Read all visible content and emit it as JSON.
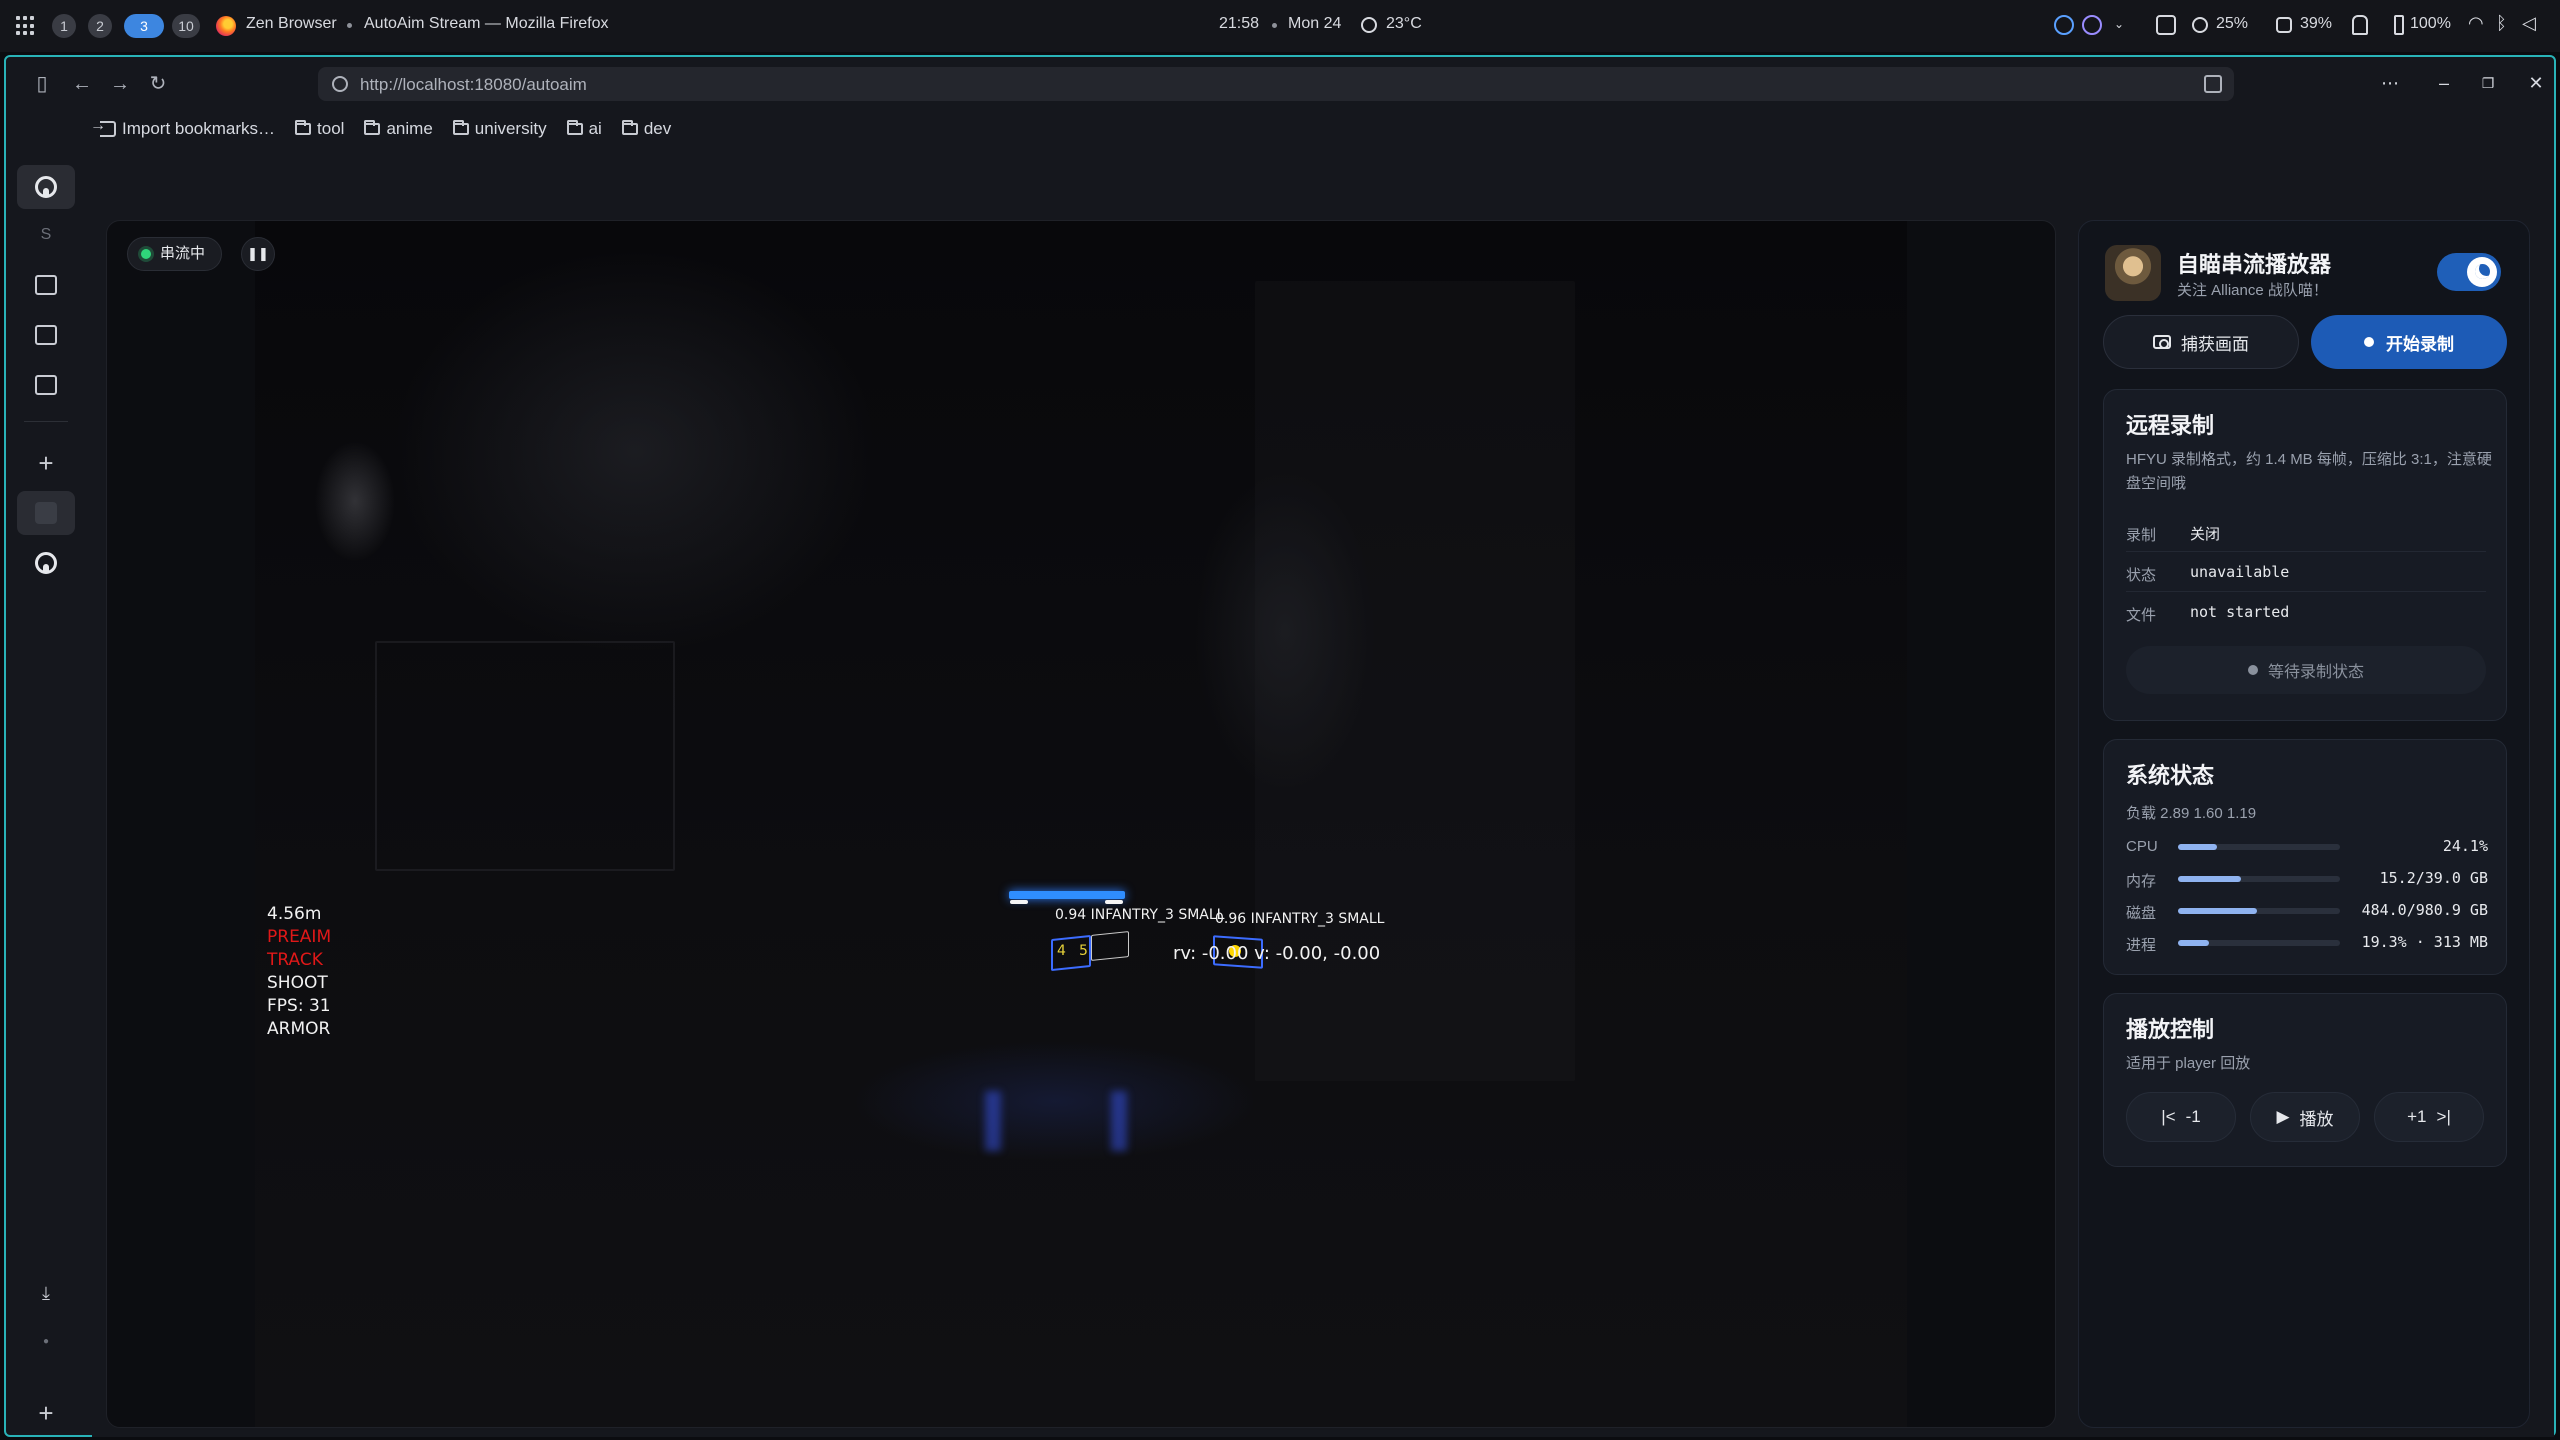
{
  "system_bar": {
    "workspaces": [
      "1",
      "2",
      "3",
      "10"
    ],
    "active_workspace": "3",
    "app_name": "Zen Browser",
    "window_title": "AutoAim Stream — Mozilla Firefox",
    "time": "21:58",
    "date": "Mon 24",
    "weather": "23°C",
    "cpu": "25%",
    "memory": "39%",
    "battery": "100%"
  },
  "browser": {
    "url": "http://localhost:18080/autoaim",
    "bookmarks": [
      "Import bookmarks…",
      "tool",
      "anime",
      "university",
      "ai",
      "dev"
    ],
    "sidebar_letter": "S"
  },
  "stream": {
    "status_badge": "串流中",
    "pause_icon": "pause-icon",
    "overlay": {
      "distance": "4.56m",
      "preaim": "PREAIM",
      "track": "TRACK",
      "shoot": "SHOOT",
      "fps": "FPS: 31",
      "mode": "ARMOR"
    },
    "detections": [
      {
        "label": "0.94  INFANTRY_3  SMALL",
        "num_a": "4",
        "num_b": "5"
      },
      {
        "label": "0.96  INFANTRY_3  SMALL"
      }
    ],
    "rv_text": "rv:  -0.00   v:  -0.00, -0.00"
  },
  "panel": {
    "title": "自瞄串流播放器",
    "subtitle": "关注 Alliance 战队喵！",
    "capture_label": "捕获画面",
    "record_label": "开始录制",
    "remote": {
      "title": "远程录制",
      "desc": "HFYU 录制格式，约 1.4 MB 每帧，压缩比 3:1，注意硬盘空间哦",
      "rows": [
        {
          "key": "录制",
          "value": "关闭"
        },
        {
          "key": "状态",
          "value": "unavailable"
        },
        {
          "key": "文件",
          "value": "not started"
        }
      ],
      "wait_label": "等待录制状态"
    },
    "system": {
      "title": "系统状态",
      "load": "负载 2.89 1.60 1.19",
      "stats": [
        {
          "label": "CPU",
          "value": "24.1%",
          "level": 0.24
        },
        {
          "label": "内存",
          "value": "15.2/39.0 GB",
          "level": 0.39
        },
        {
          "label": "磁盘",
          "value": "484.0/980.9 GB",
          "level": 0.49
        },
        {
          "label": "进程",
          "value": "19.3% · 313 MB",
          "level": 0.19
        }
      ]
    },
    "playback": {
      "title": "播放控制",
      "desc": "适用于 player 回放",
      "prev": "-1",
      "play": "播放",
      "next": "+1"
    }
  },
  "colors": {
    "accent": "#1d5bb6",
    "frame_border": "#29b3b8",
    "live_dot": "#2fd57a",
    "overlay_red": "#e01818",
    "armor_blue": "#2f7dff"
  }
}
